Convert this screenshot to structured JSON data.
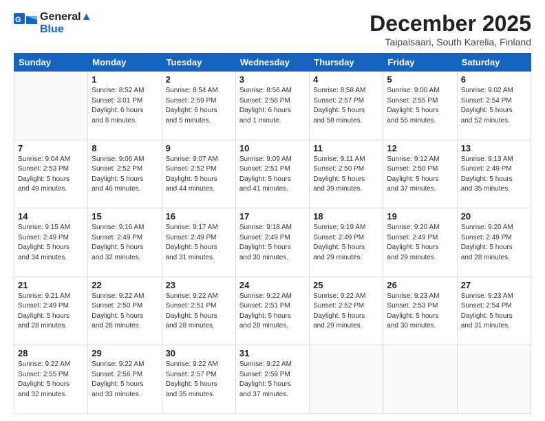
{
  "logo": {
    "line1": "General",
    "line2": "Blue"
  },
  "title": "December 2025",
  "subtitle": "Taipalsaari, South Karelia, Finland",
  "days_header": [
    "Sunday",
    "Monday",
    "Tuesday",
    "Wednesday",
    "Thursday",
    "Friday",
    "Saturday"
  ],
  "weeks": [
    [
      {
        "num": "",
        "info": ""
      },
      {
        "num": "1",
        "info": "Sunrise: 8:52 AM\nSunset: 3:01 PM\nDaylight: 6 hours\nand 8 minutes."
      },
      {
        "num": "2",
        "info": "Sunrise: 8:54 AM\nSunset: 2:59 PM\nDaylight: 6 hours\nand 5 minutes."
      },
      {
        "num": "3",
        "info": "Sunrise: 8:56 AM\nSunset: 2:58 PM\nDaylight: 6 hours\nand 1 minute."
      },
      {
        "num": "4",
        "info": "Sunrise: 8:58 AM\nSunset: 2:57 PM\nDaylight: 5 hours\nand 58 minutes."
      },
      {
        "num": "5",
        "info": "Sunrise: 9:00 AM\nSunset: 2:55 PM\nDaylight: 5 hours\nand 55 minutes."
      },
      {
        "num": "6",
        "info": "Sunrise: 9:02 AM\nSunset: 2:54 PM\nDaylight: 5 hours\nand 52 minutes."
      }
    ],
    [
      {
        "num": "7",
        "info": "Sunrise: 9:04 AM\nSunset: 2:53 PM\nDaylight: 5 hours\nand 49 minutes."
      },
      {
        "num": "8",
        "info": "Sunrise: 9:06 AM\nSunset: 2:52 PM\nDaylight: 5 hours\nand 46 minutes."
      },
      {
        "num": "9",
        "info": "Sunrise: 9:07 AM\nSunset: 2:52 PM\nDaylight: 5 hours\nand 44 minutes."
      },
      {
        "num": "10",
        "info": "Sunrise: 9:09 AM\nSunset: 2:51 PM\nDaylight: 5 hours\nand 41 minutes."
      },
      {
        "num": "11",
        "info": "Sunrise: 9:11 AM\nSunset: 2:50 PM\nDaylight: 5 hours\nand 39 minutes."
      },
      {
        "num": "12",
        "info": "Sunrise: 9:12 AM\nSunset: 2:50 PM\nDaylight: 5 hours\nand 37 minutes."
      },
      {
        "num": "13",
        "info": "Sunrise: 9:13 AM\nSunset: 2:49 PM\nDaylight: 5 hours\nand 35 minutes."
      }
    ],
    [
      {
        "num": "14",
        "info": "Sunrise: 9:15 AM\nSunset: 2:49 PM\nDaylight: 5 hours\nand 34 minutes."
      },
      {
        "num": "15",
        "info": "Sunrise: 9:16 AM\nSunset: 2:49 PM\nDaylight: 5 hours\nand 32 minutes."
      },
      {
        "num": "16",
        "info": "Sunrise: 9:17 AM\nSunset: 2:49 PM\nDaylight: 5 hours\nand 31 minutes."
      },
      {
        "num": "17",
        "info": "Sunrise: 9:18 AM\nSunset: 2:49 PM\nDaylight: 5 hours\nand 30 minutes."
      },
      {
        "num": "18",
        "info": "Sunrise: 9:19 AM\nSunset: 2:49 PM\nDaylight: 5 hours\nand 29 minutes."
      },
      {
        "num": "19",
        "info": "Sunrise: 9:20 AM\nSunset: 2:49 PM\nDaylight: 5 hours\nand 29 minutes."
      },
      {
        "num": "20",
        "info": "Sunrise: 9:20 AM\nSunset: 2:49 PM\nDaylight: 5 hours\nand 28 minutes."
      }
    ],
    [
      {
        "num": "21",
        "info": "Sunrise: 9:21 AM\nSunset: 2:49 PM\nDaylight: 5 hours\nand 28 minutes."
      },
      {
        "num": "22",
        "info": "Sunrise: 9:22 AM\nSunset: 2:50 PM\nDaylight: 5 hours\nand 28 minutes."
      },
      {
        "num": "23",
        "info": "Sunrise: 9:22 AM\nSunset: 2:51 PM\nDaylight: 5 hours\nand 28 minutes."
      },
      {
        "num": "24",
        "info": "Sunrise: 9:22 AM\nSunset: 2:51 PM\nDaylight: 5 hours\nand 28 minutes."
      },
      {
        "num": "25",
        "info": "Sunrise: 9:22 AM\nSunset: 2:52 PM\nDaylight: 5 hours\nand 29 minutes."
      },
      {
        "num": "26",
        "info": "Sunrise: 9:23 AM\nSunset: 2:53 PM\nDaylight: 5 hours\nand 30 minutes."
      },
      {
        "num": "27",
        "info": "Sunrise: 9:23 AM\nSunset: 2:54 PM\nDaylight: 5 hours\nand 31 minutes."
      }
    ],
    [
      {
        "num": "28",
        "info": "Sunrise: 9:22 AM\nSunset: 2:55 PM\nDaylight: 5 hours\nand 32 minutes."
      },
      {
        "num": "29",
        "info": "Sunrise: 9:22 AM\nSunset: 2:56 PM\nDaylight: 5 hours\nand 33 minutes."
      },
      {
        "num": "30",
        "info": "Sunrise: 9:22 AM\nSunset: 2:57 PM\nDaylight: 5 hours\nand 35 minutes."
      },
      {
        "num": "31",
        "info": "Sunrise: 9:22 AM\nSunset: 2:59 PM\nDaylight: 5 hours\nand 37 minutes."
      },
      {
        "num": "",
        "info": ""
      },
      {
        "num": "",
        "info": ""
      },
      {
        "num": "",
        "info": ""
      }
    ]
  ]
}
